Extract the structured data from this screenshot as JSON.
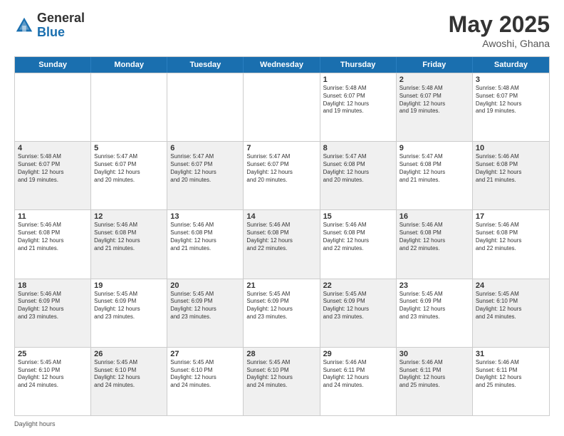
{
  "header": {
    "logo_general": "General",
    "logo_blue": "Blue",
    "title": "May 2025",
    "location": "Awoshi, Ghana"
  },
  "days_of_week": [
    "Sunday",
    "Monday",
    "Tuesday",
    "Wednesday",
    "Thursday",
    "Friday",
    "Saturday"
  ],
  "footer": "Daylight hours",
  "weeks": [
    [
      {
        "day": "",
        "info": "",
        "shaded": false
      },
      {
        "day": "",
        "info": "",
        "shaded": false
      },
      {
        "day": "",
        "info": "",
        "shaded": false
      },
      {
        "day": "",
        "info": "",
        "shaded": false
      },
      {
        "day": "1",
        "info": "Sunrise: 5:48 AM\nSunset: 6:07 PM\nDaylight: 12 hours\nand 19 minutes.",
        "shaded": false
      },
      {
        "day": "2",
        "info": "Sunrise: 5:48 AM\nSunset: 6:07 PM\nDaylight: 12 hours\nand 19 minutes.",
        "shaded": true
      },
      {
        "day": "3",
        "info": "Sunrise: 5:48 AM\nSunset: 6:07 PM\nDaylight: 12 hours\nand 19 minutes.",
        "shaded": false
      }
    ],
    [
      {
        "day": "4",
        "info": "Sunrise: 5:48 AM\nSunset: 6:07 PM\nDaylight: 12 hours\nand 19 minutes.",
        "shaded": true
      },
      {
        "day": "5",
        "info": "Sunrise: 5:47 AM\nSunset: 6:07 PM\nDaylight: 12 hours\nand 20 minutes.",
        "shaded": false
      },
      {
        "day": "6",
        "info": "Sunrise: 5:47 AM\nSunset: 6:07 PM\nDaylight: 12 hours\nand 20 minutes.",
        "shaded": true
      },
      {
        "day": "7",
        "info": "Sunrise: 5:47 AM\nSunset: 6:07 PM\nDaylight: 12 hours\nand 20 minutes.",
        "shaded": false
      },
      {
        "day": "8",
        "info": "Sunrise: 5:47 AM\nSunset: 6:08 PM\nDaylight: 12 hours\nand 20 minutes.",
        "shaded": true
      },
      {
        "day": "9",
        "info": "Sunrise: 5:47 AM\nSunset: 6:08 PM\nDaylight: 12 hours\nand 21 minutes.",
        "shaded": false
      },
      {
        "day": "10",
        "info": "Sunrise: 5:46 AM\nSunset: 6:08 PM\nDaylight: 12 hours\nand 21 minutes.",
        "shaded": true
      }
    ],
    [
      {
        "day": "11",
        "info": "Sunrise: 5:46 AM\nSunset: 6:08 PM\nDaylight: 12 hours\nand 21 minutes.",
        "shaded": false
      },
      {
        "day": "12",
        "info": "Sunrise: 5:46 AM\nSunset: 6:08 PM\nDaylight: 12 hours\nand 21 minutes.",
        "shaded": true
      },
      {
        "day": "13",
        "info": "Sunrise: 5:46 AM\nSunset: 6:08 PM\nDaylight: 12 hours\nand 21 minutes.",
        "shaded": false
      },
      {
        "day": "14",
        "info": "Sunrise: 5:46 AM\nSunset: 6:08 PM\nDaylight: 12 hours\nand 22 minutes.",
        "shaded": true
      },
      {
        "day": "15",
        "info": "Sunrise: 5:46 AM\nSunset: 6:08 PM\nDaylight: 12 hours\nand 22 minutes.",
        "shaded": false
      },
      {
        "day": "16",
        "info": "Sunrise: 5:46 AM\nSunset: 6:08 PM\nDaylight: 12 hours\nand 22 minutes.",
        "shaded": true
      },
      {
        "day": "17",
        "info": "Sunrise: 5:46 AM\nSunset: 6:08 PM\nDaylight: 12 hours\nand 22 minutes.",
        "shaded": false
      }
    ],
    [
      {
        "day": "18",
        "info": "Sunrise: 5:46 AM\nSunset: 6:09 PM\nDaylight: 12 hours\nand 23 minutes.",
        "shaded": true
      },
      {
        "day": "19",
        "info": "Sunrise: 5:45 AM\nSunset: 6:09 PM\nDaylight: 12 hours\nand 23 minutes.",
        "shaded": false
      },
      {
        "day": "20",
        "info": "Sunrise: 5:45 AM\nSunset: 6:09 PM\nDaylight: 12 hours\nand 23 minutes.",
        "shaded": true
      },
      {
        "day": "21",
        "info": "Sunrise: 5:45 AM\nSunset: 6:09 PM\nDaylight: 12 hours\nand 23 minutes.",
        "shaded": false
      },
      {
        "day": "22",
        "info": "Sunrise: 5:45 AM\nSunset: 6:09 PM\nDaylight: 12 hours\nand 23 minutes.",
        "shaded": true
      },
      {
        "day": "23",
        "info": "Sunrise: 5:45 AM\nSunset: 6:09 PM\nDaylight: 12 hours\nand 23 minutes.",
        "shaded": false
      },
      {
        "day": "24",
        "info": "Sunrise: 5:45 AM\nSunset: 6:10 PM\nDaylight: 12 hours\nand 24 minutes.",
        "shaded": true
      }
    ],
    [
      {
        "day": "25",
        "info": "Sunrise: 5:45 AM\nSunset: 6:10 PM\nDaylight: 12 hours\nand 24 minutes.",
        "shaded": false
      },
      {
        "day": "26",
        "info": "Sunrise: 5:45 AM\nSunset: 6:10 PM\nDaylight: 12 hours\nand 24 minutes.",
        "shaded": true
      },
      {
        "day": "27",
        "info": "Sunrise: 5:45 AM\nSunset: 6:10 PM\nDaylight: 12 hours\nand 24 minutes.",
        "shaded": false
      },
      {
        "day": "28",
        "info": "Sunrise: 5:45 AM\nSunset: 6:10 PM\nDaylight: 12 hours\nand 24 minutes.",
        "shaded": true
      },
      {
        "day": "29",
        "info": "Sunrise: 5:46 AM\nSunset: 6:11 PM\nDaylight: 12 hours\nand 24 minutes.",
        "shaded": false
      },
      {
        "day": "30",
        "info": "Sunrise: 5:46 AM\nSunset: 6:11 PM\nDaylight: 12 hours\nand 25 minutes.",
        "shaded": true
      },
      {
        "day": "31",
        "info": "Sunrise: 5:46 AM\nSunset: 6:11 PM\nDaylight: 12 hours\nand 25 minutes.",
        "shaded": false
      }
    ]
  ]
}
